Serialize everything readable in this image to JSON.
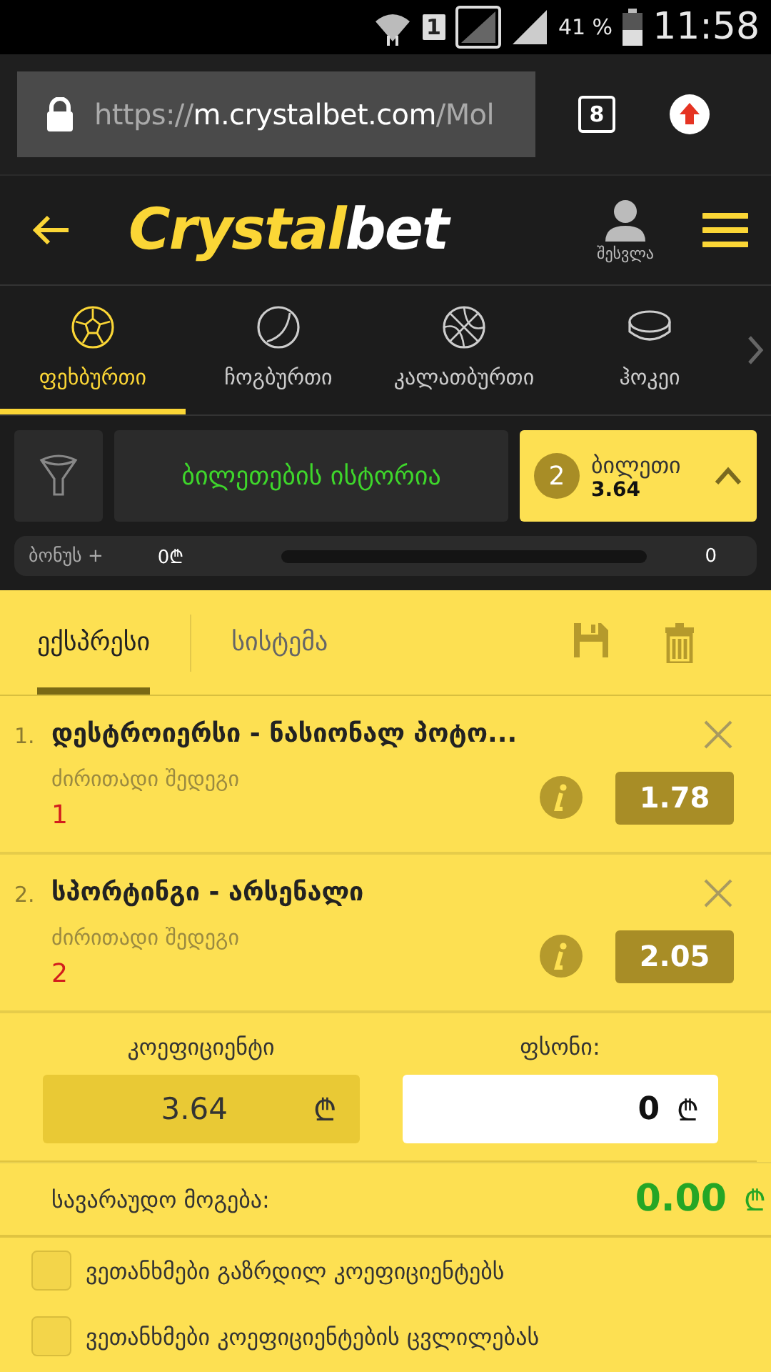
{
  "status_bar": {
    "sim": "1",
    "battery": "41 %",
    "time": "11:58"
  },
  "browser": {
    "url_scheme": "https://",
    "url_host": "m.crystalbet.com",
    "url_path": "/Mol",
    "tab_count": "8"
  },
  "header": {
    "logo_first": "Crystal",
    "logo_second": "bet",
    "login": "შესვლა"
  },
  "sports": [
    {
      "kind": "football",
      "label": "ფეხბურთი",
      "selected": true
    },
    {
      "kind": "tennis",
      "label": "ჩოგბურთი",
      "selected": false
    },
    {
      "kind": "basketball",
      "label": "კალათბურთი",
      "selected": false
    },
    {
      "kind": "hockey",
      "label": "ჰოკეი",
      "selected": false
    }
  ],
  "slip_bar": {
    "history": "ბილეთების ისტორია",
    "ticket_count": "2",
    "ticket_label": "ბილეთი",
    "ticket_odds": "3.64"
  },
  "bonus": {
    "label": "ბონუს +",
    "amount": "0₾",
    "level": 0,
    "value": "0"
  },
  "bet_slip": {
    "tabs": [
      {
        "label": "ექსპრესი",
        "selected": true
      },
      {
        "label": "სისტემა",
        "selected": false
      }
    ],
    "bets": [
      {
        "number": "1.",
        "match": "დესტროიერსი - ნასიონალ პოტო...",
        "market": "ძირითადი შედეგი",
        "pick": "1",
        "odds": "1.78"
      },
      {
        "number": "2.",
        "match": "სპორტინგი - არსენალი",
        "market": "ძირითადი შედეგი",
        "pick": "2",
        "odds": "2.05"
      }
    ],
    "coefficient": {
      "label": "კოეფიციენტი",
      "value": "3.64",
      "currency": "₾"
    },
    "stake": {
      "label": "ფსონი:",
      "value": "0",
      "currency": "₾"
    },
    "potential": {
      "label": "სავარაუდო მოგება:",
      "value": "0.00",
      "currency": "₾"
    },
    "options": [
      {
        "label": "ვეთანხმები გაზრდილ კოეფიციენტებს",
        "checked": false
      },
      {
        "label": "ვეთანხმები კოეფიციენტების ცვლილებას",
        "checked": false
      }
    ]
  }
}
